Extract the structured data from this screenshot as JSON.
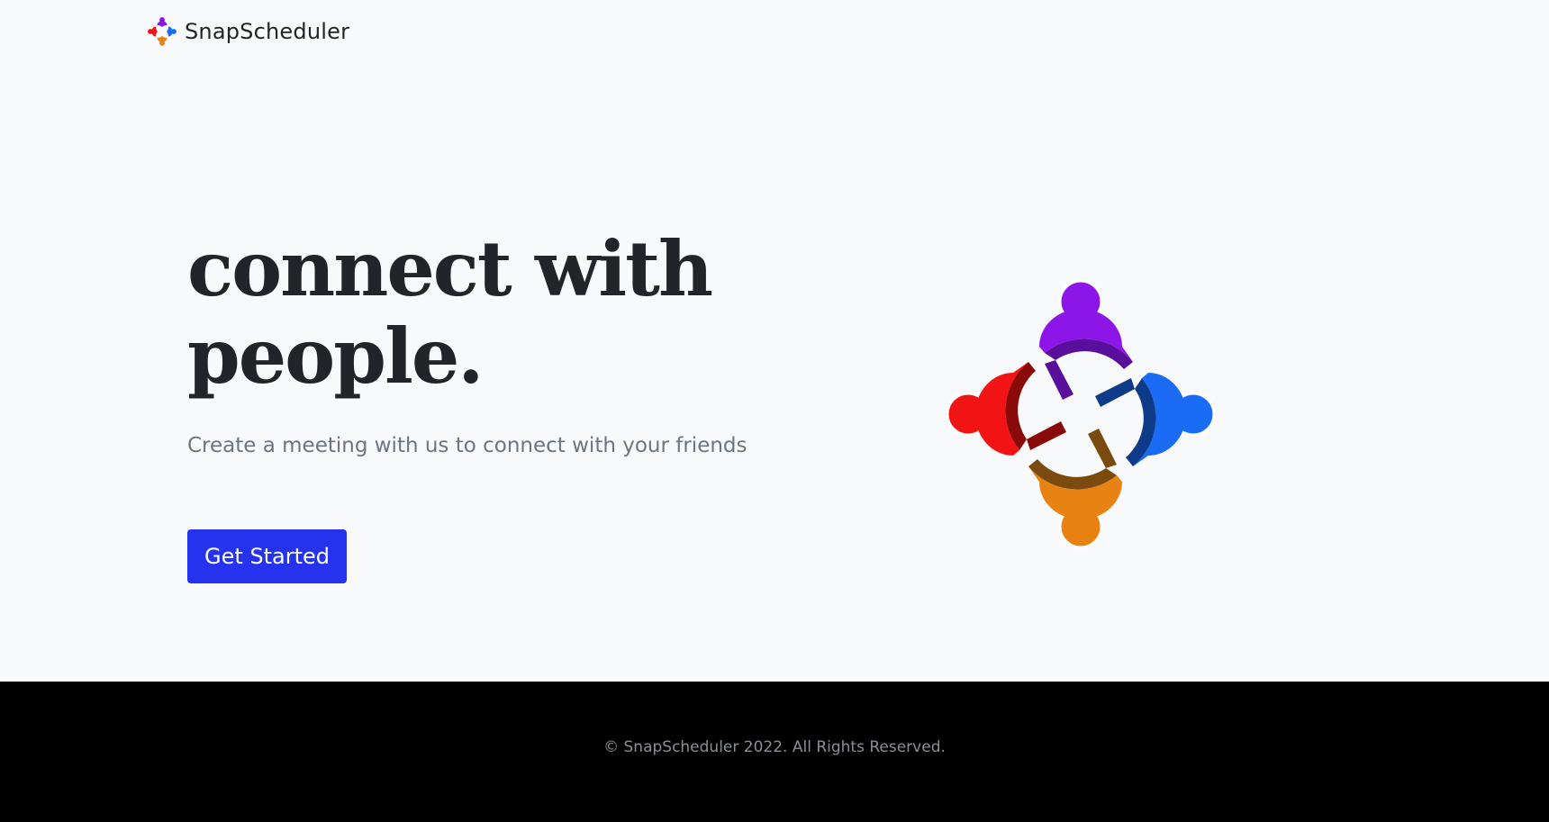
{
  "navbar": {
    "brand_name": "SnapScheduler",
    "logo_icon": "people-circle-logo-icon"
  },
  "hero": {
    "title_line1": "connect with",
    "title_line2": "people.",
    "subtitle": "Create a meeting with us to connect with your friends",
    "cta_label": "Get Started",
    "illustration_icon": "four-people-circle-illustration"
  },
  "footer": {
    "copyright": "© SnapScheduler 2022. All Rights Reserved."
  },
  "colors": {
    "accent": "#2633ee",
    "person_top": "#8c16e8",
    "person_right": "#1a6cf5",
    "person_bottom": "#e88212",
    "person_left": "#f21414",
    "footer_bg": "#000000"
  }
}
